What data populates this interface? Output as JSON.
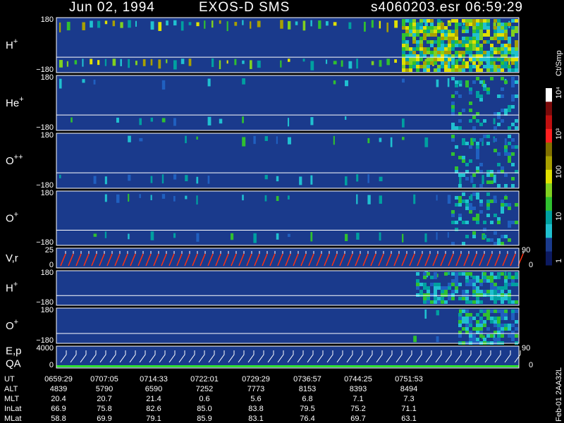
{
  "header": {
    "date": "Jun 02, 1994",
    "instrument": "EXOS-D SMS",
    "file": "s4060203.esr",
    "time": "06:59:29"
  },
  "colors": {
    "background": "#000000",
    "plot_bg": "#1a3a8c",
    "trace": "#ffffff",
    "vr_line": "#ff3010",
    "qa_green": "#30e030"
  },
  "colorbar": {
    "unit_label": "Ct/Smp",
    "ticks": [
      "10⁴",
      "10³",
      "100",
      "10",
      "1"
    ],
    "stops": [
      "#ffffff",
      "#7a0a0a",
      "#c01010",
      "#ff2020",
      "#807000",
      "#a8a000",
      "#e0e000",
      "#80d020",
      "#30c030",
      "#00a0a0",
      "#20c0d0",
      "#1a3a8c",
      "#0c1a60"
    ]
  },
  "chart_data": {
    "type": "heatmap",
    "panels": [
      {
        "label": "H",
        "sup": "+",
        "ticks": [
          "180",
          "−180"
        ],
        "right_ticks": []
      },
      {
        "label": "He",
        "sup": "+",
        "ticks": [
          "180",
          "−180"
        ],
        "right_ticks": []
      },
      {
        "label": "O",
        "sup": "++",
        "ticks": [
          "180",
          "−180"
        ],
        "right_ticks": []
      },
      {
        "label": "O",
        "sup": "+",
        "ticks": [
          "180",
          "−180"
        ],
        "right_ticks": []
      },
      {
        "label": "V,r",
        "sup": "",
        "ticks": [
          "25",
          "0"
        ],
        "right_ticks": [
          "90",
          "0"
        ]
      },
      {
        "label": "H",
        "sup": "+",
        "ticks": [
          "180",
          "−180"
        ],
        "right_ticks": []
      },
      {
        "label": "O",
        "sup": "+",
        "ticks": [
          "180",
          "−180"
        ],
        "right_ticks": []
      },
      {
        "label": "E,p",
        "label2": "QA",
        "sup": "",
        "ticks": [
          "4000",
          "0"
        ],
        "right_ticks": [
          "90",
          "0"
        ]
      }
    ]
  },
  "footer": {
    "rows": [
      {
        "label": "UT",
        "values": [
          "0659:29",
          "0707:05",
          "0714:33",
          "0722:01",
          "0729:29",
          "0736:57",
          "0744:25",
          "0751:53"
        ]
      },
      {
        "label": "ALT",
        "values": [
          "4839",
          "5790",
          "6590",
          "7252",
          "7773",
          "8153",
          "8393",
          "8494"
        ]
      },
      {
        "label": "MLT",
        "values": [
          "20.4",
          "20.7",
          "21.4",
          "0.6",
          "5.6",
          "6.8",
          "7.1",
          "7.3"
        ]
      },
      {
        "label": "InLat",
        "values": [
          "66.9",
          "75.8",
          "82.6",
          "85.0",
          "83.8",
          "79.5",
          "75.2",
          "71.1"
        ]
      },
      {
        "label": "MLat",
        "values": [
          "58.8",
          "69.9",
          "79.1",
          "85.9",
          "83.1",
          "76.4",
          "69.7",
          "63.1"
        ]
      }
    ],
    "stamp": "Feb-01 2AA32L"
  }
}
